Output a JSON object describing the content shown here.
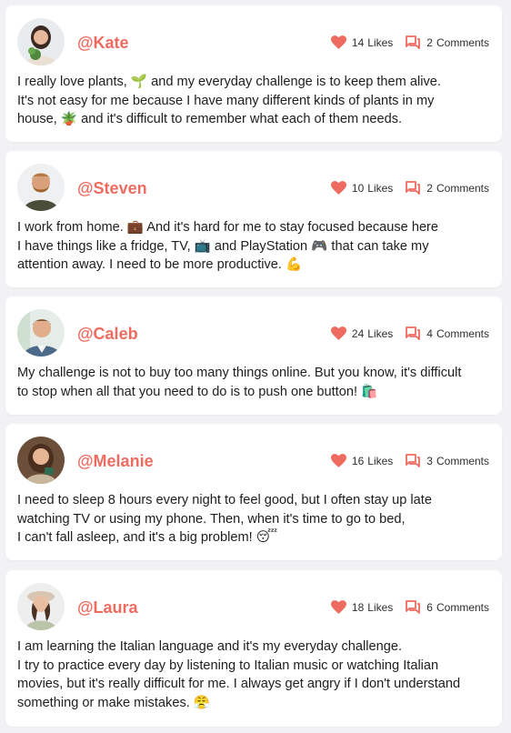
{
  "posts": [
    {
      "username": "@Kate",
      "likes": "14",
      "likes_label": "Likes",
      "comments": "2",
      "comments_label": "Comments",
      "text": "I really love plants, 🌱 and my everyday challenge is to keep them alive.\nIt's not easy for me because I have many different kinds of plants in my\nhouse, 🪴 and it's difficult to remember what each of them needs."
    },
    {
      "username": "@Steven",
      "likes": "10",
      "likes_label": "Likes",
      "comments": "2",
      "comments_label": "Comments",
      "text": "I work from home. 💼 And it's hard for me to stay focused because here\nI have things like a fridge, TV, 📺 and PlayStation 🎮 that can take my\nattention away. I need to be more productive. 💪"
    },
    {
      "username": "@Caleb",
      "likes": "24",
      "likes_label": "Likes",
      "comments": "4",
      "comments_label": "Comments",
      "text": "My challenge is not to buy too many things online. But you know, it's difficult\nto stop when all that you need to do is to push one button! 🛍️"
    },
    {
      "username": "@Melanie",
      "likes": "16",
      "likes_label": "Likes",
      "comments": "3",
      "comments_label": "Comments",
      "text": "I need to sleep 8 hours every night to feel good, but I often stay up late\nwatching TV or using my phone. Then, when it's time to go to bed,\nI can't fall asleep, and it's a big problem! 😴"
    },
    {
      "username": "@Laura",
      "likes": "18",
      "likes_label": "Likes",
      "comments": "6",
      "comments_label": "Comments",
      "text": "I am learning the Italian language and it's my everyday challenge.\nI try to practice every day by listening to Italian music or watching Italian\nmovies, but it's really difficult for me. I always get angry if I don't understand\nsomething or make mistakes. 😤"
    }
  ],
  "colors": {
    "accent": "#ee6b60",
    "background": "#f2f2f4",
    "card": "#ffffff"
  },
  "icons": {
    "like": "heart-icon",
    "comment": "comment-icon"
  }
}
